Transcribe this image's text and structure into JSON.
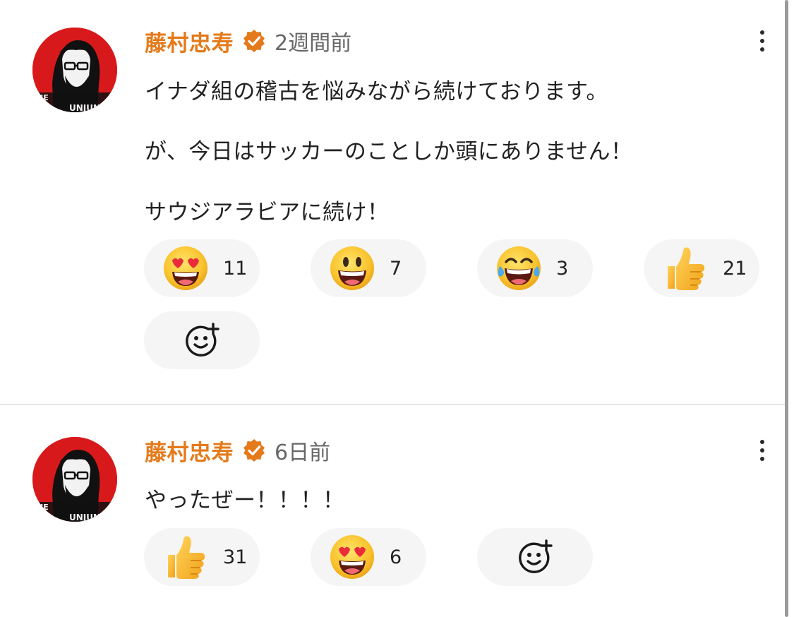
{
  "comments": [
    {
      "author": "藤村忠寿",
      "time": "2週間前",
      "lines": [
        "イナダ組の稽古を悩みながら続けております。",
        "が、今日はサッカーのことしか頭にありません！",
        "サウジアラビアに続け！"
      ],
      "reactions": [
        {
          "icon": "heart-eyes-emoji",
          "count": "11"
        },
        {
          "icon": "grinning-emoji",
          "count": "7"
        },
        {
          "icon": "tears-of-joy-emoji",
          "count": "3"
        },
        {
          "icon": "thumbs-up-emoji",
          "count": "21"
        }
      ]
    },
    {
      "author": "藤村忠寿",
      "time": "6日前",
      "lines": [
        "やったぜー！！！！"
      ],
      "reactions": [
        {
          "icon": "thumbs-up-emoji",
          "count": "31"
        },
        {
          "icon": "heart-eyes-emoji",
          "count": "6"
        }
      ]
    }
  ],
  "colors": {
    "author": "#e47a1b",
    "pill_bg": "#f5f5f5"
  }
}
